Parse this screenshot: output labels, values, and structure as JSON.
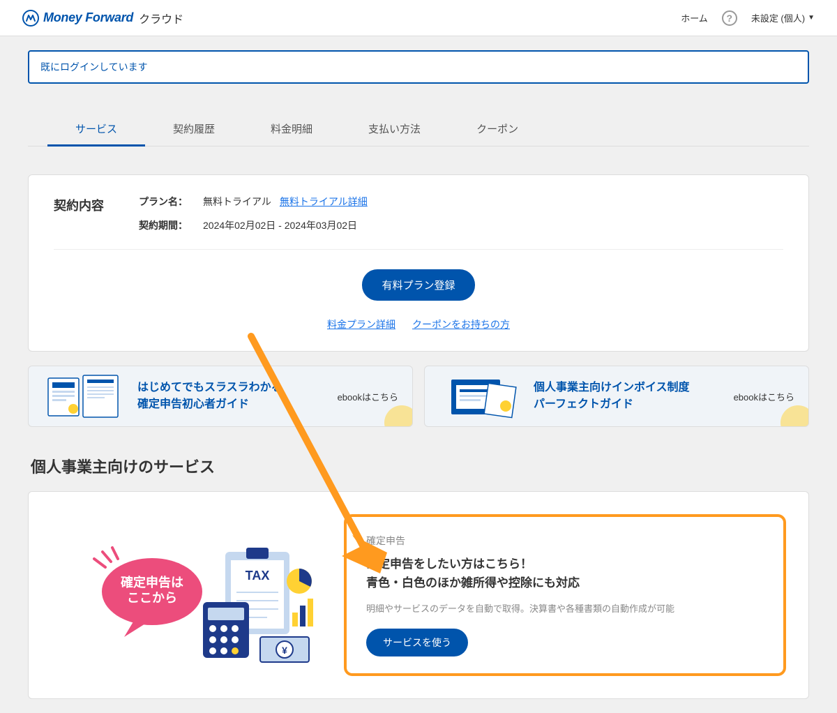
{
  "header": {
    "logo_text": "Money Forward",
    "logo_sub": "クラウド",
    "home_link": "ホーム",
    "user_label": "未設定 (個人)"
  },
  "notice": "既にログインしています",
  "tabs": [
    "サービス",
    "契約履歴",
    "料金明細",
    "支払い方法",
    "クーポン"
  ],
  "contract": {
    "title": "契約内容",
    "plan_label": "プラン名：",
    "plan_value": "無料トライアル",
    "plan_link": "無料トライアル詳細",
    "period_label": "契約期間：",
    "period_value": "2024年02月02日 - 2024年03月02日",
    "register_btn": "有料プラン登録",
    "link1": "料金プラン詳細",
    "link2": "クーポンをお持ちの方"
  },
  "banners": [
    {
      "line1": "はじめてでもスラスラわかる",
      "line2": "確定申告初心者ガイド",
      "cta": "ebookはこちら"
    },
    {
      "line1": "個人事業主向けインボイス制度",
      "line2": "パーフェクトガイド",
      "cta": "ebookはこちら"
    }
  ],
  "section_title": "個人事業主向けのサービス",
  "service": {
    "bubble_line1": "確定申告は",
    "bubble_line2": "ここから",
    "tax_label": "TAX",
    "tag": "確定申告",
    "heading_line1": "確定申告をしたい方はこちら！",
    "heading_line2": "青色・白色のほか雑所得や控除にも対応",
    "desc": "明細やサービスのデータを自動で取得。決算書や各種書類の自動作成が可能",
    "btn": "サービスを使う"
  }
}
